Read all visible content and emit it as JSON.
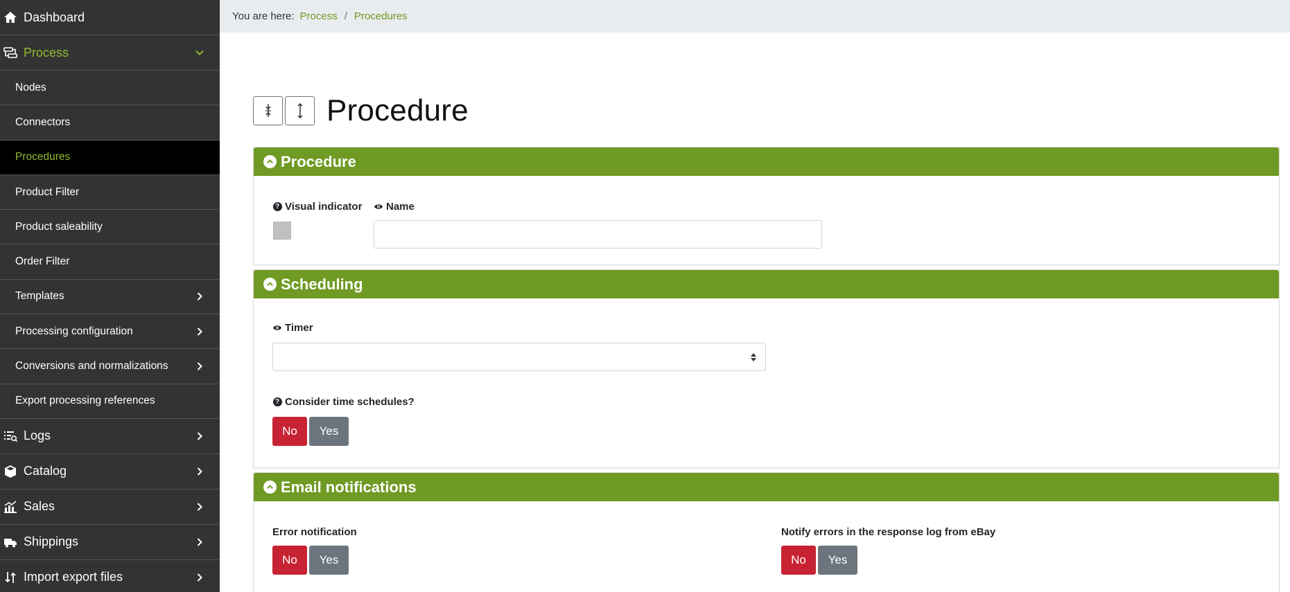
{
  "sidebar": {
    "items": [
      {
        "label": "Dashboard",
        "icon": "home-icon"
      },
      {
        "label": "Process",
        "icon": "process-icon"
      },
      {
        "label": "Nodes"
      },
      {
        "label": "Connectors"
      },
      {
        "label": "Procedures"
      },
      {
        "label": "Product Filter"
      },
      {
        "label": "Product saleability"
      },
      {
        "label": "Order Filter"
      },
      {
        "label": "Templates"
      },
      {
        "label": "Processing configuration"
      },
      {
        "label": "Conversions and normalizations"
      },
      {
        "label": "Export processing references"
      },
      {
        "label": "Logs",
        "icon": "logs-icon"
      },
      {
        "label": "Catalog",
        "icon": "catalog-icon"
      },
      {
        "label": "Sales",
        "icon": "sales-icon"
      },
      {
        "label": "Shippings",
        "icon": "truck-icon"
      },
      {
        "label": "Import export files",
        "icon": "import-export-icon"
      }
    ]
  },
  "breadcrumb": {
    "prefix": "You are here:",
    "items": [
      "Process",
      "Procedures"
    ],
    "separator": "/"
  },
  "page": {
    "title": "Procedure"
  },
  "panels": {
    "procedure": {
      "title": "Procedure",
      "visual_indicator_label": "Visual indicator",
      "name_label": "Name",
      "name_value": ""
    },
    "scheduling": {
      "title": "Scheduling",
      "timer_label": "Timer",
      "timer_value": "",
      "consider_label": "Consider time schedules?",
      "consider_no": "No",
      "consider_yes": "Yes"
    },
    "email": {
      "title": "Email notifications",
      "error_label": "Error notification",
      "error_no": "No",
      "error_yes": "Yes",
      "ebay_label": "Notify errors in the response log from eBay",
      "ebay_no": "No",
      "ebay_yes": "Yes"
    }
  },
  "colors": {
    "sidebar_bg": "#333333",
    "accent_green": "#6f9a23",
    "link_green": "#8fbc2e",
    "no_red": "#c82333",
    "yes_gray": "#6c757d",
    "swatch": "#c0c0c0"
  }
}
